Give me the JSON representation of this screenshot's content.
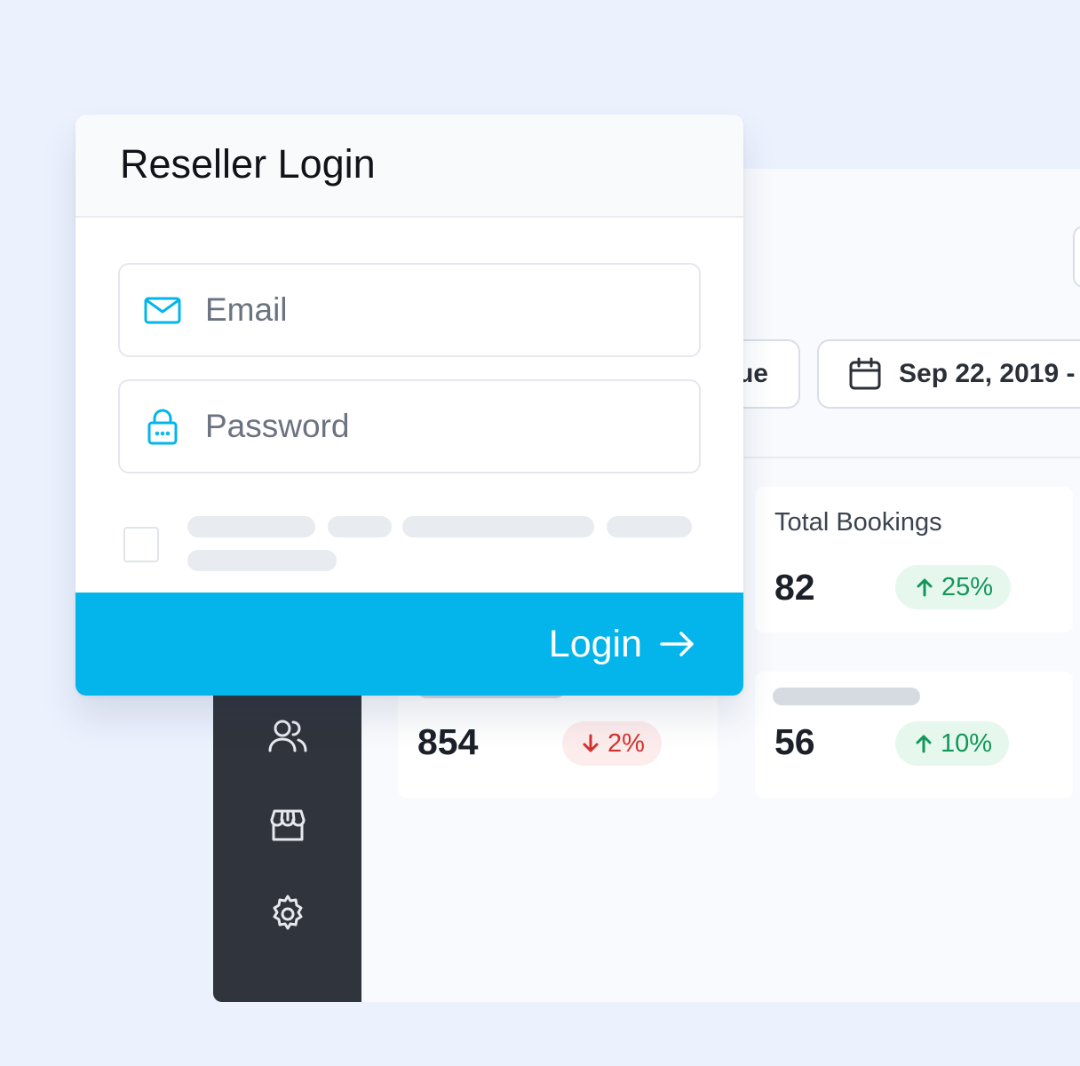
{
  "login": {
    "title": "Reseller Login",
    "email_placeholder": "Email",
    "password_placeholder": "Password",
    "button_label": "Login"
  },
  "filters": {
    "revenue_label_fragment": "ue",
    "date_label": "Sep 22, 2019 -"
  },
  "stats": [
    {
      "label": "Total Bookings",
      "value": "82",
      "change": "25%",
      "direction": "up"
    },
    {
      "label": "",
      "value": "854",
      "change": "2%",
      "direction": "down"
    },
    {
      "label": "",
      "value": "56",
      "change": "10%",
      "direction": "up"
    }
  ],
  "sidebar": {
    "icons": [
      "users-icon",
      "store-icon",
      "settings-gear-icon"
    ]
  },
  "colors": {
    "accent": "#03B5EA",
    "sidebar": "#30343C",
    "background": "#EBF1FD",
    "positive": "#13965A",
    "negative": "#D3332F"
  }
}
